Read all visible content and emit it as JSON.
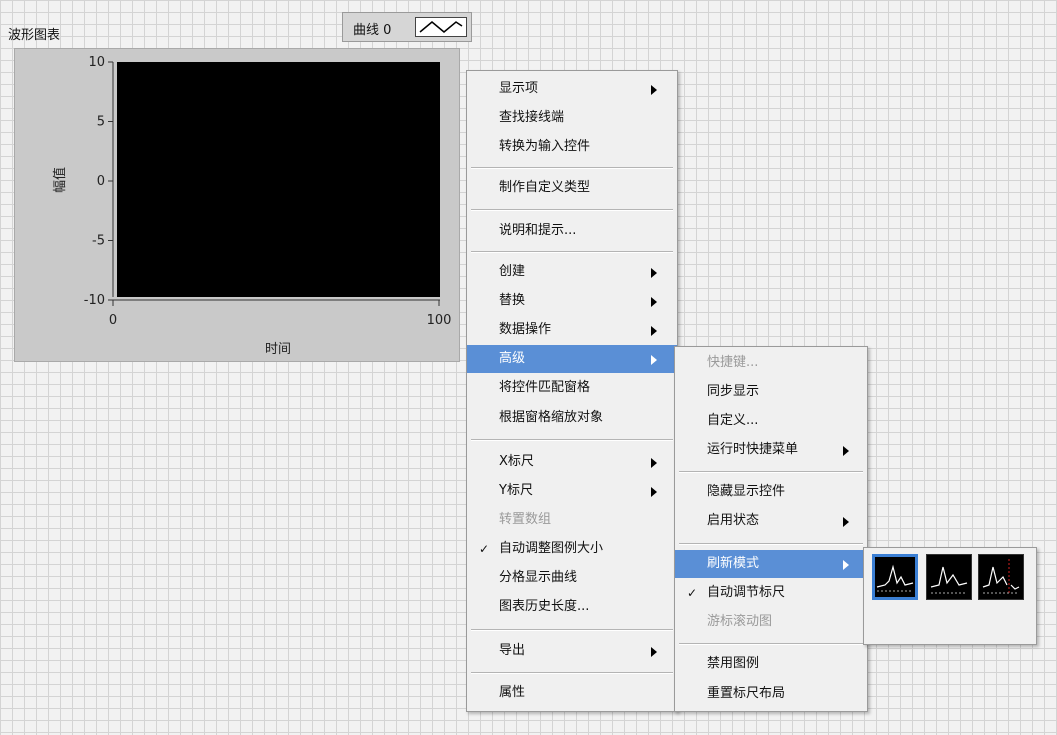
{
  "chart": {
    "label": "波形图表",
    "legend_name": "曲线 0",
    "y_axis_label": "幅值",
    "x_axis_label": "时间",
    "y_ticks": [
      "10",
      "5",
      "0",
      "-5",
      "-10"
    ],
    "x_ticks": [
      "0",
      "100"
    ],
    "plot_bg": "#000000"
  },
  "context_menu": {
    "items": [
      {
        "label": "显示项",
        "submenu": true
      },
      {
        "label": "查找接线端"
      },
      {
        "label": "转换为输入控件"
      },
      {
        "label": "制作自定义类型"
      },
      {
        "label": "说明和提示..."
      },
      {
        "label": "创建",
        "submenu": true
      },
      {
        "label": "替换",
        "submenu": true
      },
      {
        "label": "数据操作",
        "submenu": true
      },
      {
        "label": "高级",
        "submenu": true,
        "highlighted": true
      },
      {
        "label": "将控件匹配窗格"
      },
      {
        "label": "根据窗格缩放对象"
      },
      {
        "label": "X标尺",
        "submenu": true
      },
      {
        "label": "Y标尺",
        "submenu": true
      },
      {
        "label": "转置数组",
        "disabled": true
      },
      {
        "label": "自动调整图例大小",
        "checked": true
      },
      {
        "label": "分格显示曲线"
      },
      {
        "label": "图表历史长度..."
      },
      {
        "label": "导出",
        "submenu": true
      },
      {
        "label": "属性"
      }
    ]
  },
  "advanced_submenu": {
    "items": [
      {
        "label": "快捷键...",
        "disabled": true
      },
      {
        "label": "同步显示"
      },
      {
        "label": "自定义..."
      },
      {
        "label": "运行时快捷菜单",
        "submenu": true
      },
      {
        "label": "隐藏显示控件"
      },
      {
        "label": "启用状态",
        "submenu": true
      },
      {
        "label": "刷新模式",
        "submenu": true,
        "highlighted": true
      },
      {
        "label": "自动调节标尺",
        "checked": true
      },
      {
        "label": "游标滚动图",
        "disabled": true
      },
      {
        "label": "禁用图例"
      },
      {
        "label": "重置标尺布局"
      }
    ]
  },
  "refresh_mode_palette": {
    "modes": [
      "strip-chart",
      "scope-chart",
      "sweep-chart"
    ],
    "selected_index": 0
  },
  "check_glyph": "✓",
  "colors": {
    "highlight": "#5a8fd6",
    "grid_line": "#d4d4d4",
    "selection_border": "#3b7fd4",
    "sweep_line": "#d02020"
  }
}
